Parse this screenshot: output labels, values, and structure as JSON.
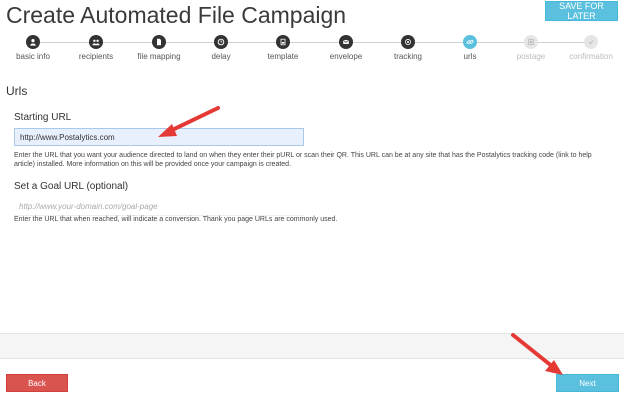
{
  "header": {
    "title": "Create Automated File Campaign",
    "save_label": "SAVE FOR LATER"
  },
  "steps": [
    {
      "label": "basic info",
      "icon": "person-icon",
      "state": "done"
    },
    {
      "label": "recipients",
      "icon": "group-icon",
      "state": "done"
    },
    {
      "label": "file mapping",
      "icon": "file-icon",
      "state": "done"
    },
    {
      "label": "delay",
      "icon": "clock-icon",
      "state": "done"
    },
    {
      "label": "template",
      "icon": "template-icon",
      "state": "done"
    },
    {
      "label": "envelope",
      "icon": "envelope-icon",
      "state": "done"
    },
    {
      "label": "tracking",
      "icon": "tracking-icon",
      "state": "done"
    },
    {
      "label": "urls",
      "icon": "link-icon",
      "state": "active"
    },
    {
      "label": "postage",
      "icon": "postage-icon",
      "state": "disabled"
    },
    {
      "label": "confirmation",
      "icon": "check-icon",
      "state": "disabled"
    }
  ],
  "main": {
    "section_title": "Urls",
    "starting_url": {
      "label": "Starting URL",
      "value": "http://www.Postalytics.com",
      "help": "Enter the URL that you want your audience directed to land on when they enter their pURL or scan their QR. This URL can be at any site that has the Postalytics tracking code (link to help article) installed. More information on this will be provided once your campaign is created."
    },
    "goal_url": {
      "label": "Set a Goal URL (optional)",
      "placeholder": "http://www.your-domain.com/goal-page",
      "help": "Enter the URL that when reached, will indicate a conversion. Thank you page URLs are commonly used."
    }
  },
  "footer": {
    "back_label": "Back",
    "next_label": "Next"
  },
  "colors": {
    "accent": "#5bc0de",
    "danger": "#d9534f",
    "annotation_arrow": "#e53935"
  }
}
